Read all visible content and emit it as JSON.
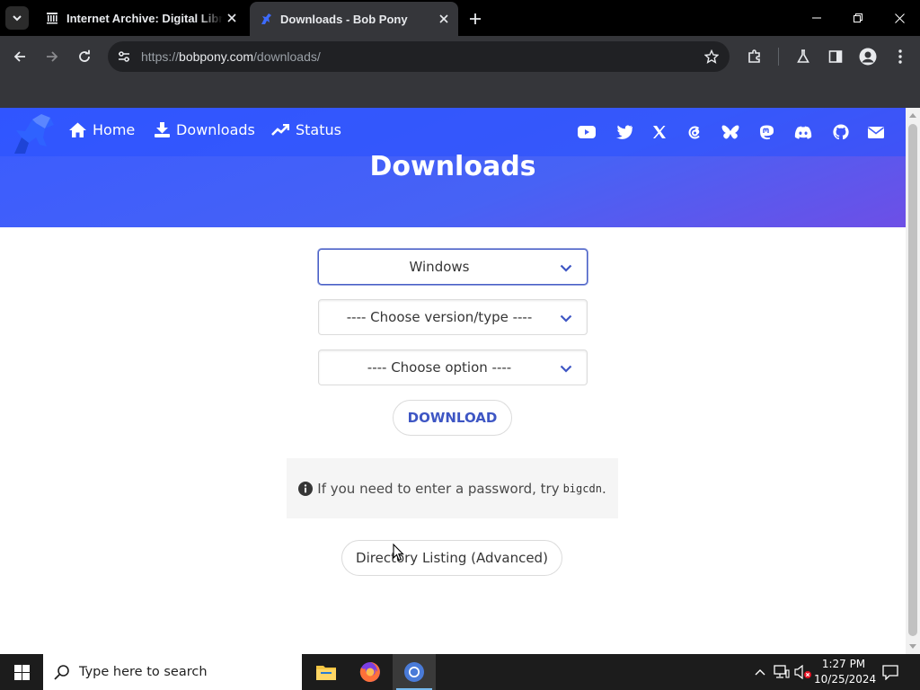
{
  "browser": {
    "tabs": [
      {
        "title": "Internet Archive: Digital Library",
        "favicon": "archive-icon",
        "active": false
      },
      {
        "title": "Downloads - Bob Pony",
        "favicon": "bobpony-icon",
        "active": true
      }
    ],
    "url": {
      "scheme": "https://",
      "host": "bobpony.com",
      "path": "/downloads/"
    }
  },
  "site": {
    "nav": {
      "home": "Home",
      "downloads": "Downloads",
      "status": "Status"
    },
    "social_icons": [
      "youtube-icon",
      "twitter-icon",
      "x-icon",
      "threads-icon",
      "bluesky-icon",
      "mastodon-icon",
      "discord-icon",
      "github-icon",
      "email-icon"
    ],
    "hero_title": "Downloads",
    "os_select": {
      "selected": "Windows"
    },
    "version_select": {
      "selected": "---- Choose version/type ----"
    },
    "option_select": {
      "selected": "---- Choose option ----"
    },
    "download_button": "DOWNLOAD",
    "notice": {
      "text": "If you need to enter a password, try",
      "code": "bigcdn",
      "end": "."
    },
    "directory_button": "Directory Listing (Advanced)"
  },
  "colors": {
    "hero": "#3a5cff",
    "link": "#3e56c4"
  },
  "taskbar": {
    "search_placeholder": "Type here to search",
    "apps": [
      "file-explorer-icon",
      "firefox-icon",
      "chrome-icon"
    ],
    "time": "1:27 PM",
    "date": "10/25/2024"
  }
}
